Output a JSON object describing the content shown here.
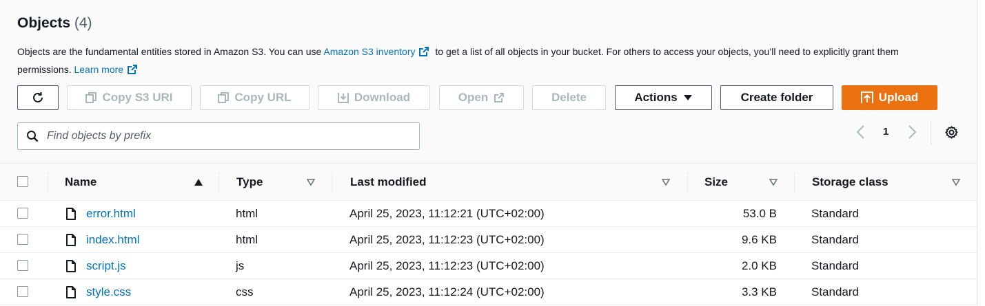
{
  "header": {
    "title": "Objects",
    "count": "(4)"
  },
  "description": {
    "part1": "Objects are the fundamental entities stored in Amazon S3. You can use ",
    "link1": "Amazon S3 inventory",
    "part2": " to get a list of all objects in your bucket. For others to access your objects, you’ll need to explicitly grant them permissions.",
    "link2": "Learn more"
  },
  "toolbar": {
    "copy_s3_uri": "Copy S3 URI",
    "copy_url": "Copy URL",
    "download": "Download",
    "open": "Open",
    "delete": "Delete",
    "actions": "Actions",
    "create_folder": "Create folder",
    "upload": "Upload"
  },
  "search": {
    "placeholder": "Find objects by prefix"
  },
  "pagination": {
    "page": "1"
  },
  "table": {
    "columns": {
      "name": "Name",
      "type": "Type",
      "last_modified": "Last modified",
      "size": "Size",
      "storage_class": "Storage class"
    },
    "rows": [
      {
        "name": "error.html",
        "type": "html",
        "last_modified": "April 25, 2023, 11:12:21 (UTC+02:00)",
        "size": "53.0 B",
        "storage_class": "Standard"
      },
      {
        "name": "index.html",
        "type": "html",
        "last_modified": "April 25, 2023, 11:12:23 (UTC+02:00)",
        "size": "9.6 KB",
        "storage_class": "Standard"
      },
      {
        "name": "script.js",
        "type": "js",
        "last_modified": "April 25, 2023, 11:12:23 (UTC+02:00)",
        "size": "2.0 KB",
        "storage_class": "Standard"
      },
      {
        "name": "style.css",
        "type": "css",
        "last_modified": "April 25, 2023, 11:12:24 (UTC+02:00)",
        "size": "3.3 KB",
        "storage_class": "Standard"
      }
    ]
  },
  "colors": {
    "link": "#0073bb",
    "primary": "#ec7211",
    "disabled": "#aab7b8"
  }
}
